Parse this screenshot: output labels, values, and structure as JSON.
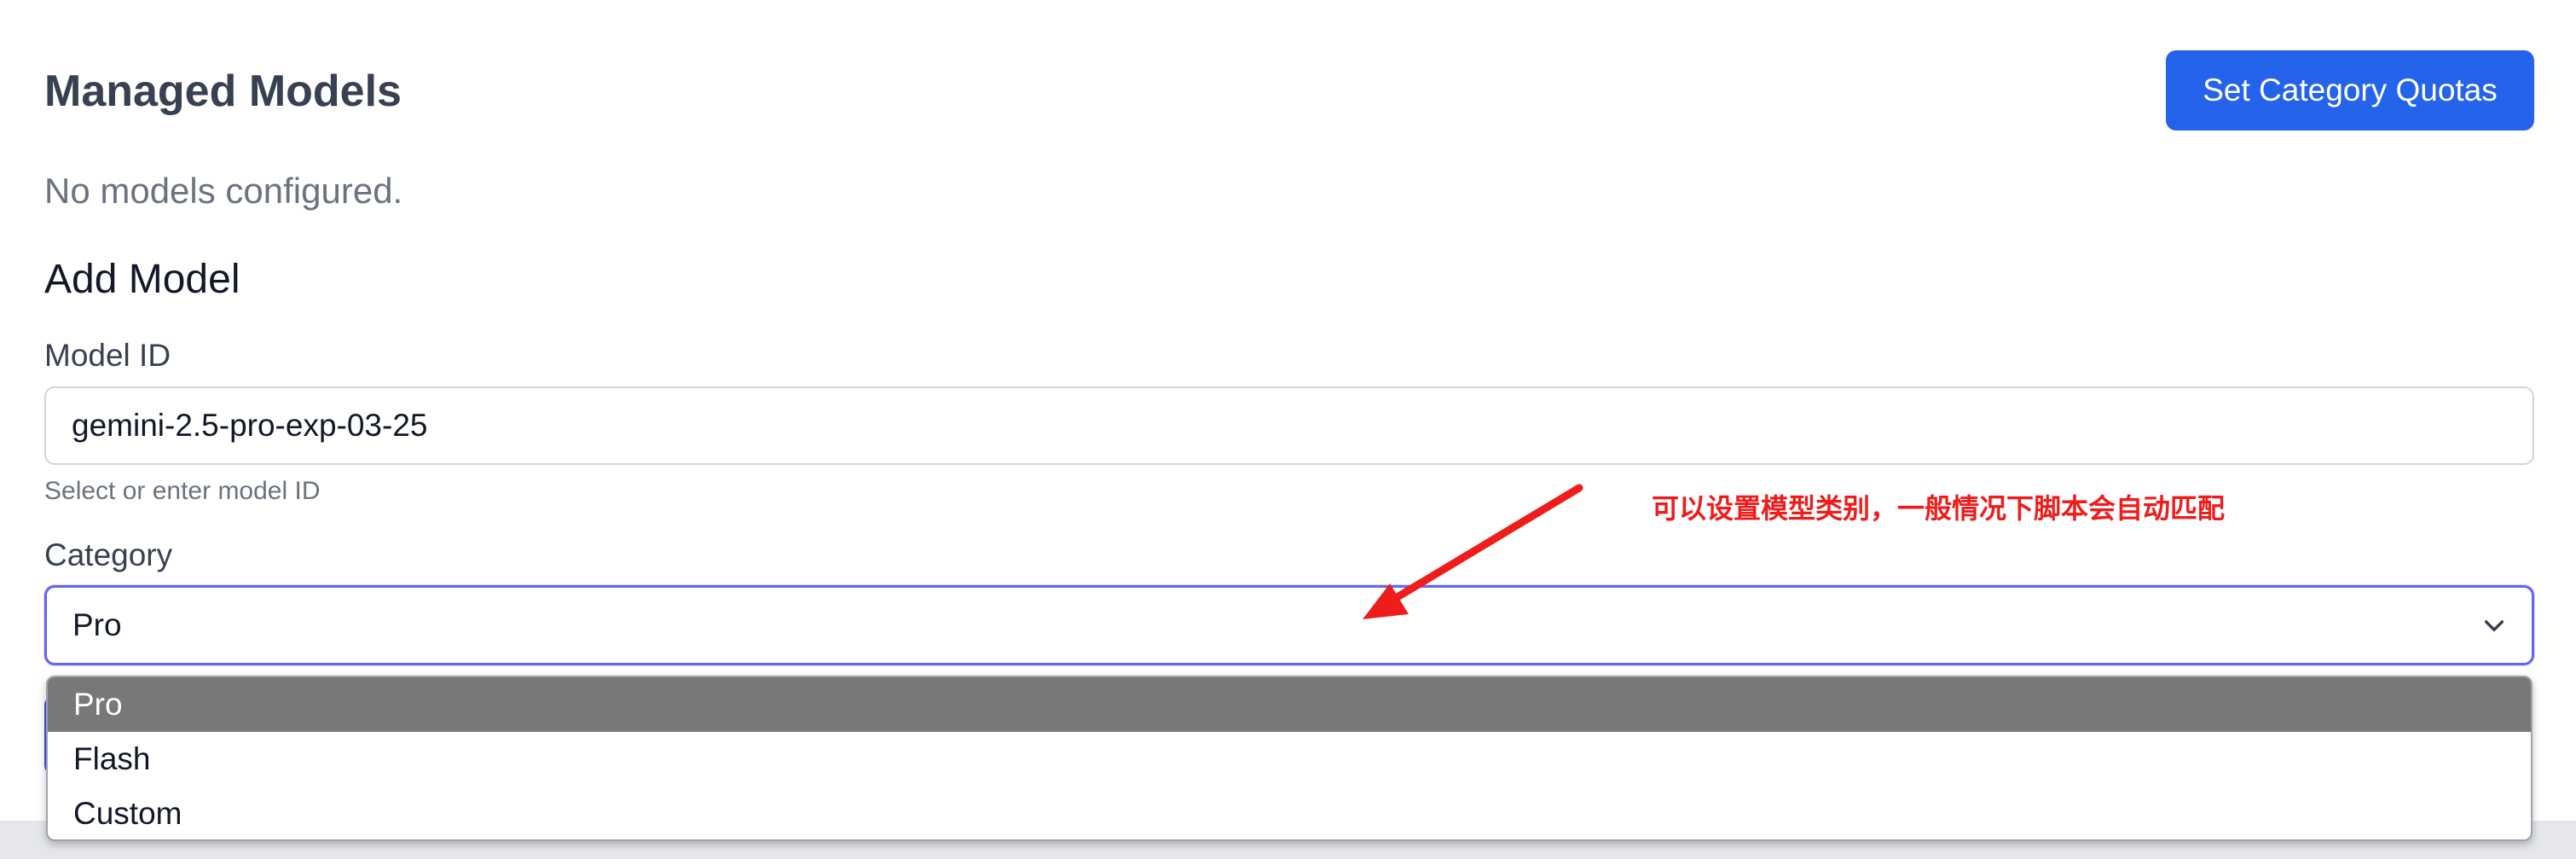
{
  "header": {
    "title": "Managed Models",
    "quota_button_label": "Set Category Quotas"
  },
  "models": {
    "empty_message": "No models configured."
  },
  "add_model": {
    "title": "Add Model",
    "model_id": {
      "label": "Model ID",
      "value": "gemini-2.5-pro-exp-03-25",
      "help": "Select or enter model ID"
    },
    "category": {
      "label": "Category",
      "selected": "Pro",
      "options": [
        "Pro",
        "Flash",
        "Custom"
      ]
    }
  },
  "annotation": {
    "text": "可以设置模型类别，一般情况下脚本会自动匹配",
    "color": "#ef1c1c"
  },
  "colors": {
    "primary": "#2563eb",
    "focus_ring": "#6366f1",
    "option_highlight": "#787878"
  },
  "icons": {
    "select_chevron": "chevron-down-icon",
    "annotation_arrow": "arrow-icon"
  }
}
